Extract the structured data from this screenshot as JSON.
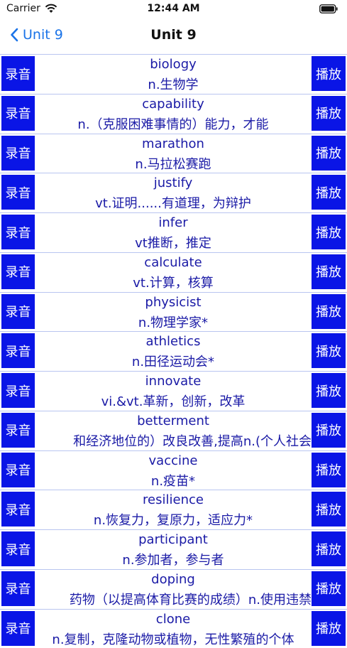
{
  "status": {
    "carrier": "Carrier",
    "time": "12:44 AM"
  },
  "nav": {
    "back_label": "Unit 9",
    "title": "Unit 9"
  },
  "buttons": {
    "record": "录音",
    "play": "播放"
  },
  "vocab": [
    {
      "word": "biology",
      "meaning": "n.生物学"
    },
    {
      "word": "capability",
      "meaning": "n.（克服困难事情的）能力，才能"
    },
    {
      "word": "marathon",
      "meaning": "n.马拉松赛跑"
    },
    {
      "word": "justify",
      "meaning": "vt.证明......有道理，为辩护"
    },
    {
      "word": "infer",
      "meaning": "vt推断，推定"
    },
    {
      "word": "calculate",
      "meaning": "vt.计算，核算"
    },
    {
      "word": "physicist",
      "meaning": "n.物理学家*"
    },
    {
      "word": "athletics",
      "meaning": "n.田径运动会*"
    },
    {
      "word": "innovate",
      "meaning": "vi.&vt.革新，创新，改革"
    },
    {
      "word": "betterment",
      "meaning": "和经济地位的）改良改善,提高n.(个人社会"
    },
    {
      "word": "vaccine",
      "meaning": "n.疫苗*"
    },
    {
      "word": "resilience",
      "meaning": "n.恢复力，复原力，适应力*"
    },
    {
      "word": "participant",
      "meaning": "n.参加者，参与者"
    },
    {
      "word": "doping",
      "meaning": "药物（以提高体育比赛的成绩）n.使用违禁"
    },
    {
      "word": "clone",
      "meaning": "n.复制，克隆动物或植物，无性繁殖的个体"
    }
  ],
  "colors": {
    "button_bg": "#0a15e6",
    "link": "#1a73e8",
    "text": "#1a1aa6",
    "divider": "#b9c5f0"
  }
}
